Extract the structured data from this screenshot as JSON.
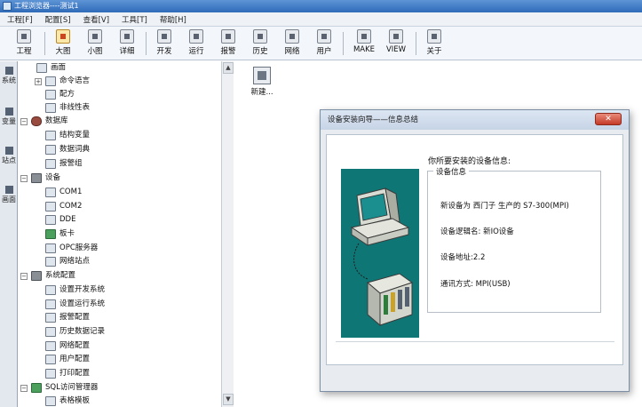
{
  "window": {
    "title": "工程浏览器----测试1"
  },
  "menu": [
    "工程[F]",
    "配置[S]",
    "查看[V]",
    "工具[T]",
    "帮助[H]"
  ],
  "toolbar": [
    {
      "label": "工程",
      "icon": "project-icon"
    },
    {
      "label": "大图",
      "icon": "large-icons-icon"
    },
    {
      "label": "小图",
      "icon": "small-icons-icon"
    },
    {
      "label": "详细",
      "icon": "details-icon"
    },
    {
      "label": "开发",
      "icon": "develop-icon"
    },
    {
      "label": "运行",
      "icon": "run-icon"
    },
    {
      "label": "报警",
      "icon": "alarm-icon"
    },
    {
      "label": "历史",
      "icon": "history-icon"
    },
    {
      "label": "网络",
      "icon": "network-icon"
    },
    {
      "label": "用户",
      "icon": "user-icon"
    },
    {
      "label": "MAKE",
      "icon": "make-icon"
    },
    {
      "label": "VIEW",
      "icon": "view-icon"
    },
    {
      "label": "关于",
      "icon": "about-icon"
    }
  ],
  "vtabs": [
    "系统",
    "变量",
    "站点",
    "画面"
  ],
  "tree": [
    {
      "label": "画面",
      "expander": "",
      "icon": "screen-icon"
    },
    {
      "label": "命令语言",
      "expander": "+",
      "icon": "command-icon"
    },
    {
      "label": "配方",
      "expander": "",
      "icon": "recipe-icon"
    },
    {
      "label": "非线性表",
      "expander": "",
      "icon": "table-icon"
    },
    {
      "label": "数据库",
      "expander": "−",
      "icon": "database-icon"
    },
    {
      "label": "结构变量",
      "expander": "",
      "icon": "struct-icon"
    },
    {
      "label": "数据词典",
      "expander": "",
      "icon": "dictionary-icon"
    },
    {
      "label": "报警组",
      "expander": "",
      "icon": "alarm-group-icon"
    },
    {
      "label": "设备",
      "expander": "−",
      "icon": "device-icon"
    },
    {
      "label": "COM1",
      "expander": "",
      "icon": "com-port-icon"
    },
    {
      "label": "COM2",
      "expander": "",
      "icon": "com-port-icon"
    },
    {
      "label": "DDE",
      "expander": "",
      "icon": "dde-icon"
    },
    {
      "label": "板卡",
      "expander": "",
      "icon": "board-icon"
    },
    {
      "label": "OPC服务器",
      "expander": "",
      "icon": "opc-icon"
    },
    {
      "label": "网络站点",
      "expander": "",
      "icon": "network-station-icon"
    },
    {
      "label": "系统配置",
      "expander": "−",
      "icon": "tools-icon"
    },
    {
      "label": "设置开发系统",
      "expander": "",
      "icon": "settings-icon"
    },
    {
      "label": "设置运行系统",
      "expander": "",
      "icon": "settings-icon"
    },
    {
      "label": "报警配置",
      "expander": "",
      "icon": "alarm-config-icon"
    },
    {
      "label": "历史数据记录",
      "expander": "",
      "icon": "history-log-icon"
    },
    {
      "label": "网络配置",
      "expander": "",
      "icon": "network-config-icon"
    },
    {
      "label": "用户配置",
      "expander": "",
      "icon": "user-config-icon"
    },
    {
      "label": "打印配置",
      "expander": "",
      "icon": "print-icon"
    },
    {
      "label": "SQL访问管理器",
      "expander": "−",
      "icon": "sql-icon"
    },
    {
      "label": "表格模板",
      "expander": "",
      "icon": "template-icon"
    }
  ],
  "right_pane": {
    "new_item_label": "新建..."
  },
  "dialog": {
    "title": "设备安装向导——信息总结",
    "close": "✕",
    "intro": "你所要安装的设备信息:",
    "group_title": "设备信息",
    "lines": [
      "新设备为 西门子 生产的 S7-300(MPI)",
      "设备逻辑名: 新IO设备",
      "设备地址:2.2",
      "通讯方式:      MPI(USB)"
    ]
  }
}
